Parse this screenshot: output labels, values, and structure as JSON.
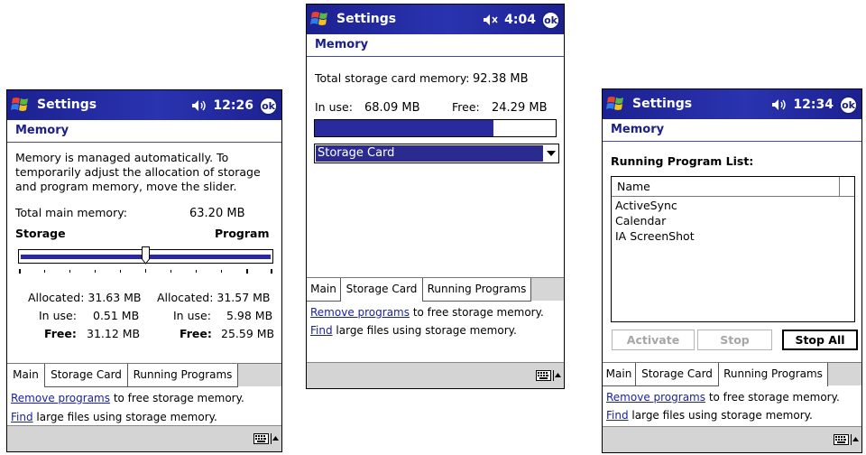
{
  "common": {
    "app_title": "Settings",
    "section": "Memory",
    "tabs": [
      "Main",
      "Storage Card",
      "Running Programs"
    ],
    "remove_link": "Remove programs",
    "remove_rest": " to free storage memory.",
    "find_link": "Find",
    "find_rest": " large files using storage memory.",
    "ok_label": "ok"
  },
  "screen_main": {
    "time": "12:26",
    "desc": [
      "Memory is managed automatically. To",
      "temporarily adjust the allocation of storage",
      "and program memory, move the slider."
    ],
    "total_label": "Total main memory:",
    "total_value": "63.20 MB",
    "storage_label": "Storage",
    "program_label": "Program",
    "slider_fraction": 0.5,
    "storage": {
      "allocated": "Allocated: 31.63 MB",
      "inuse_label": "In use:",
      "inuse": "0.51 MB",
      "free_label": "Free:",
      "free": "31.12 MB"
    },
    "program": {
      "allocated": "Allocated: 31.57 MB",
      "inuse_label": "In use:",
      "inuse": "5.98 MB",
      "free_label": "Free:",
      "free": "25.59 MB"
    },
    "active_tab": 0
  },
  "screen_card": {
    "time": "4:04",
    "total_label": "Total storage card memory:",
    "total_value": "92.38 MB",
    "inuse_label": "In use:",
    "inuse_value": "68.09 MB",
    "free_label": "Free:",
    "free_value": "24.29 MB",
    "used_fraction": 0.74,
    "card_select": "Storage Card",
    "active_tab": 1
  },
  "screen_running": {
    "time": "12:34",
    "list_title": "Running Program List:",
    "column": "Name",
    "programs": [
      "ActiveSync",
      "Calendar",
      "IA ScreenShot"
    ],
    "buttons": {
      "activate": "Activate",
      "stop": "Stop",
      "stop_all": "Stop All"
    },
    "active_tab": 2
  },
  "colors": {
    "titlebar": "#1c2190",
    "accent": "#2a2aa0",
    "header_text": "#1b1f86",
    "link": "#1b22a0"
  }
}
